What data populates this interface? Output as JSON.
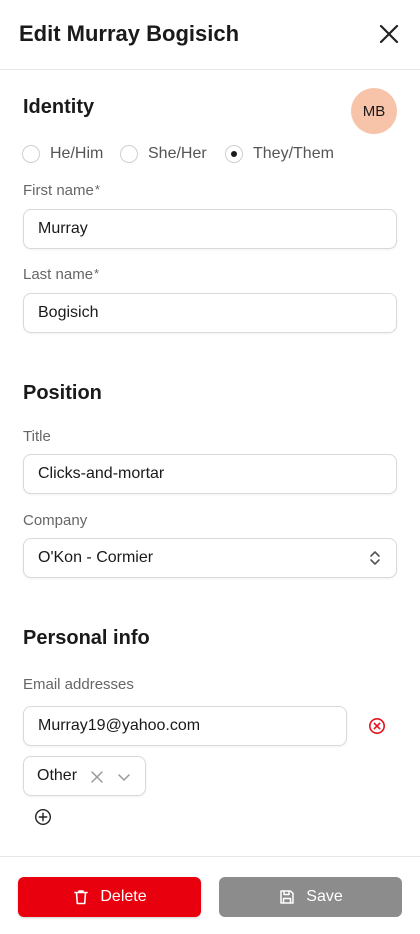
{
  "header": {
    "title": "Edit Murray Bogisich"
  },
  "identity": {
    "section_title": "Identity",
    "avatar_initials": "MB",
    "avatar_color": "#f7c4aa",
    "pronouns": [
      {
        "label": "He/Him",
        "checked": false
      },
      {
        "label": "She/Her",
        "checked": false
      },
      {
        "label": "They/Them",
        "checked": true
      }
    ],
    "first_name_label": "First name",
    "first_name_value": "Murray",
    "last_name_label": "Last name",
    "last_name_value": "Bogisich",
    "required_marker": "*"
  },
  "position": {
    "section_title": "Position",
    "title_label": "Title",
    "title_value": "Clicks-and-mortar",
    "company_label": "Company",
    "company_value": "O'Kon - Cormier"
  },
  "personal": {
    "section_title": "Personal info",
    "email_label": "Email addresses",
    "email_value": "Murray19@yahoo.com",
    "email_type": "Other"
  },
  "footer": {
    "delete_label": "Delete",
    "save_label": "Save",
    "delete_color": "#e8000f",
    "save_color": "#8c8c8c"
  }
}
